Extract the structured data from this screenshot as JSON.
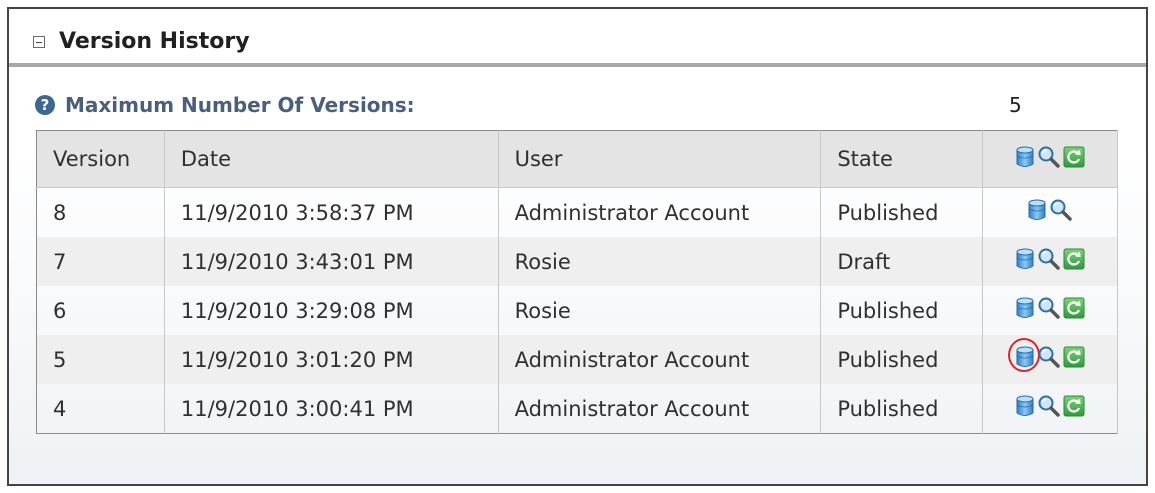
{
  "section": {
    "title": "Version History"
  },
  "max_versions": {
    "label": "Maximum Number Of Versions:",
    "value": "5"
  },
  "table": {
    "headers": {
      "version": "Version",
      "date": "Date",
      "user": "User",
      "state": "State"
    },
    "rows": [
      {
        "version": "8",
        "date": "11/9/2010 3:58:37 PM",
        "user": "Administrator Account",
        "state": "Published",
        "restore": false,
        "highlighted": false
      },
      {
        "version": "7",
        "date": "11/9/2010 3:43:01 PM",
        "user": "Rosie",
        "state": "Draft",
        "restore": true,
        "highlighted": false
      },
      {
        "version": "6",
        "date": "11/9/2010 3:29:08 PM",
        "user": "Rosie",
        "state": "Published",
        "restore": true,
        "highlighted": false
      },
      {
        "version": "5",
        "date": "11/9/2010 3:01:20 PM",
        "user": "Administrator Account",
        "state": "Published",
        "restore": true,
        "highlighted": true
      },
      {
        "version": "4",
        "date": "11/9/2010 3:00:41 PM",
        "user": "Administrator Account",
        "state": "Published",
        "restore": true,
        "highlighted": false
      }
    ]
  },
  "icons": {
    "delete": "database-delete-icon",
    "preview": "magnifier-preview-icon",
    "restore": "restore-version-icon",
    "help": "help-icon",
    "collapse": "collapse-icon"
  },
  "colors": {
    "highlight_ring": "#d8242b",
    "label_blue": "#4a5f7e",
    "restore_green": "#3aa84a",
    "db_blue": "#4a9de0"
  }
}
